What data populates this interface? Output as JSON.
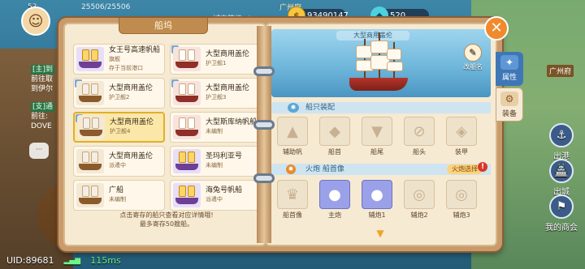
{
  "hud": {
    "avatar_level": "53",
    "exp": "25506/25506",
    "city_level": "城市等级: A",
    "city_name": "广州府",
    "gold": "93490147",
    "gems": "520"
  },
  "side_messages": [
    {
      "tag": "[主]到",
      "text": "前往取\n到伊尔"
    },
    {
      "tag": "[支]通",
      "text": "前往:\nDOVE"
    }
  ],
  "chat_bubble": "···",
  "footer": {
    "uid": "UID:89681",
    "ping": "115ms"
  },
  "right_bg_buttons": [
    {
      "label": "出港",
      "icon": "⚓"
    },
    {
      "label": "出城",
      "icon": "🏯"
    },
    {
      "label": "我的商会",
      "icon": "⚑"
    }
  ],
  "guangzhou_flag": "广州府",
  "panel": {
    "left_title": "船坞",
    "ships": [
      {
        "name": "女王号高速帆船",
        "sub": "旗舰",
        "sub2": "存于当前港口",
        "theme": "purple",
        "num": ""
      },
      {
        "name": "大型商用盖伦",
        "sub": "护卫舰1",
        "theme": "red",
        "num": "1"
      },
      {
        "name": "大型商用盖伦",
        "sub": "护卫舰2",
        "theme": "brown",
        "num": "2"
      },
      {
        "name": "大型商用盖伦",
        "sub": "护卫舰3",
        "theme": "red",
        "num": "3"
      },
      {
        "name": "大型商用盖伦",
        "sub": "护卫舰4",
        "theme": "brown",
        "num": "4",
        "selected": true
      },
      {
        "name": "大型斯库纳帆船",
        "sub": "未编制",
        "theme": "red",
        "num": ""
      },
      {
        "name": "大型商用盖伦",
        "sub": "派遣中",
        "theme": "brown",
        "num": ""
      },
      {
        "name": "圣玛利亚号",
        "sub": "未编制",
        "theme": "purple",
        "num": ""
      },
      {
        "name": "广船",
        "sub": "未编制",
        "theme": "brown",
        "num": ""
      },
      {
        "name": "海兔号帆船",
        "sub": "派遣中",
        "theme": "purple",
        "num": ""
      }
    ],
    "note_line1": "点击寄存的船只查看对应详情哦!",
    "note_line2": "最多寄存50艘船。",
    "ship_banner": "大型商用盖伦",
    "rename_label": "改船名",
    "equip_section": "船只装配",
    "equip_slots": [
      {
        "label": "辅助帆",
        "icon": "▲"
      },
      {
        "label": "船首",
        "icon": "◆"
      },
      {
        "label": "船尾",
        "icon": "▼"
      },
      {
        "label": "船头",
        "icon": "⊘"
      },
      {
        "label": "装甲",
        "icon": "◈"
      }
    ],
    "cannon_section": "火炮  船首像",
    "cannon_button": "火炮选择",
    "cannon_warn": "!",
    "cannon_slots": [
      {
        "label": "船首像",
        "icon": "♛",
        "filled": false
      },
      {
        "label": "主炮",
        "icon": "●",
        "filled": true
      },
      {
        "label": "辅炮1",
        "icon": "●",
        "filled": true
      },
      {
        "label": "辅炮2",
        "icon": "◎",
        "filled": false
      },
      {
        "label": "辅炮3",
        "icon": "◎",
        "filled": false
      }
    ],
    "tabs": [
      {
        "label": "属性",
        "icon": "✦"
      },
      {
        "label": "装备",
        "icon": "⚙"
      }
    ]
  },
  "colors": {
    "accent_orange": "#f08a2c",
    "page_bg": "#f6ead2",
    "selected_border": "#e2ad2c",
    "tab_blue": "#3f77b6"
  }
}
